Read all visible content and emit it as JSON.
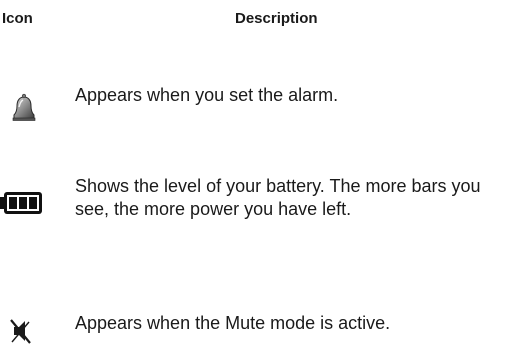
{
  "table": {
    "headers": {
      "icon": "Icon",
      "description": "Description"
    },
    "rows": [
      {
        "icon": "alarm-bell-icon",
        "description": "Appears when you set the alarm."
      },
      {
        "icon": "battery-level-icon",
        "description": "Shows the level of your battery. The more bars you see, the more power you have left."
      },
      {
        "icon": "mute-speaker-icon",
        "description": "Appears when the Mute mode is active."
      }
    ]
  }
}
